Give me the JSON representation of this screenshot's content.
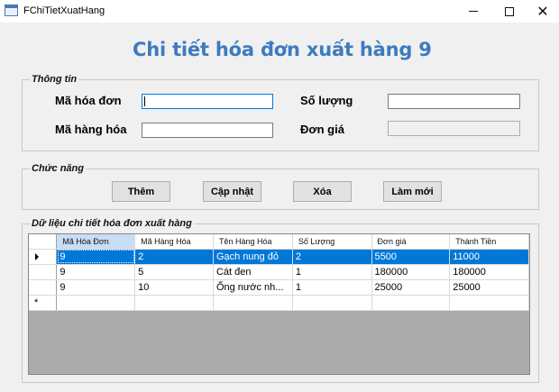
{
  "window": {
    "title": "FChiTietXuatHang",
    "close_glyph": "✕"
  },
  "heading": "Chi tiết hóa đơn xuất hàng 9",
  "info_group": {
    "legend": "Thông tin",
    "ma_hoa_don_label": "Mã hóa đơn",
    "ma_hoa_don_value": "",
    "ma_hang_hoa_label": "Mã hàng hóa",
    "ma_hang_hoa_value": "",
    "so_luong_label": "Số lượng",
    "so_luong_value": "",
    "don_gia_label": "Đơn giá",
    "don_gia_value": ""
  },
  "function_group": {
    "legend": "Chức năng",
    "add_label": "Thêm",
    "update_label": "Cập nhật",
    "delete_label": "Xóa",
    "refresh_label": "Làm mới"
  },
  "data_group": {
    "legend": "Dữ liệu chi tiết hóa đơn xuất hàng",
    "columns": [
      "Mã Hóa Đơn",
      "Mã Hàng Hóa",
      "Tên Hàng Hóa",
      "Số Lượng",
      "Đơn giá",
      "Thành Tiền"
    ],
    "rows": [
      [
        "9",
        "2",
        "Gạch nung đỏ",
        "2",
        "5500",
        "11000"
      ],
      [
        "9",
        "5",
        "Cát đen",
        "1",
        "180000",
        "180000"
      ],
      [
        "9",
        "10",
        "Ống nước nh...",
        "1",
        "25000",
        "25000"
      ]
    ],
    "selected_row": 0,
    "new_row_marker": "*"
  },
  "colors": {
    "heading": "#3c7bbf",
    "selection": "#0078d7"
  }
}
